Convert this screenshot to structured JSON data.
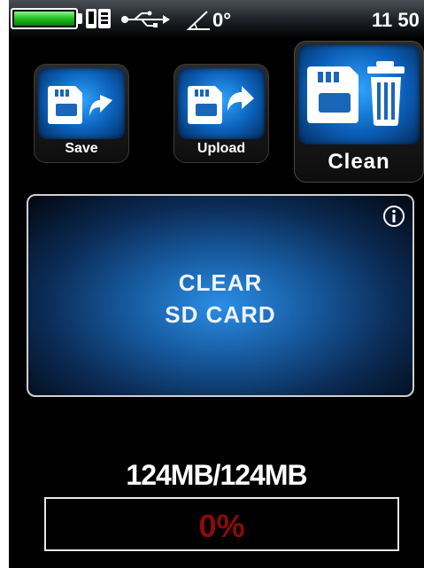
{
  "status_bar": {
    "battery_level": 1.0,
    "angle": "0°",
    "clock": "11 50",
    "icons": [
      "battery-icon",
      "device-icon",
      "usb-icon",
      "angle-icon"
    ]
  },
  "actions": {
    "save_label": "Save",
    "upload_label": "Upload",
    "clean_label": "Clean"
  },
  "panel": {
    "line1": "CLEAR",
    "line2": "SD CARD",
    "info_icon": "info-icon"
  },
  "storage": {
    "capacity": "124MB/124MB",
    "progress_text": "0%",
    "progress_fraction": 0.0
  },
  "colors": {
    "accent_blue": "#1e7fd8",
    "battery_green": "#1fbf1f",
    "progress_red": "#8b0a0a"
  }
}
